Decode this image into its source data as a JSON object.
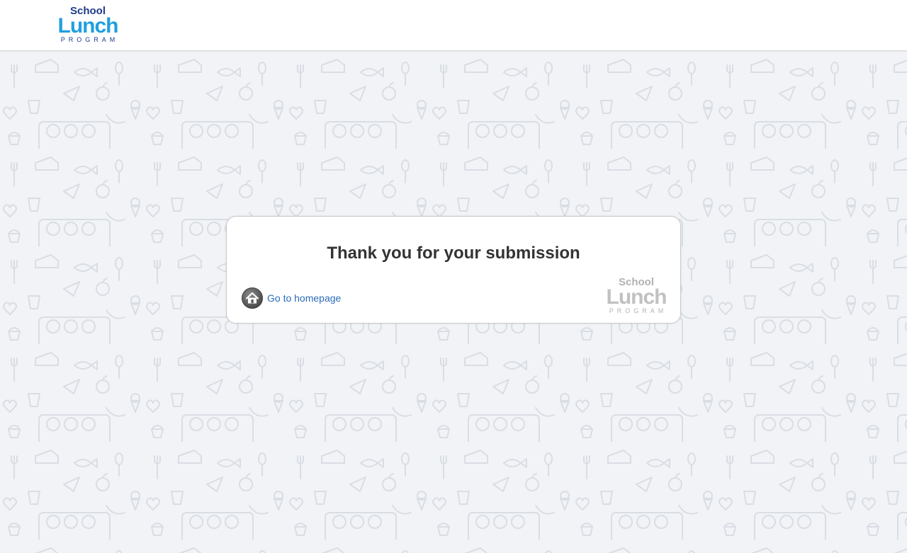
{
  "header": {
    "logo": {
      "line1": "School",
      "line2": "Lunch",
      "line3": "PROGRAM"
    }
  },
  "card": {
    "title": "Thank you for your submission",
    "home_link_label": "Go to homepage",
    "watermark_logo": {
      "line1": "School",
      "line2": "Lunch",
      "line3": "PROGRAM"
    }
  },
  "colors": {
    "brand_dark_blue": "#1e3a8a",
    "brand_light_blue": "#1f9fe0",
    "link_blue": "#2a6cb8",
    "background": "#f1f3f6"
  },
  "icons": {
    "home": "home-icon",
    "pattern_items": [
      "fork-icon",
      "spoon-icon",
      "apple-icon",
      "ice-cream-icon",
      "pizza-slice-icon",
      "cup-icon",
      "fish-icon",
      "cheese-icon",
      "plate-icon"
    ]
  }
}
